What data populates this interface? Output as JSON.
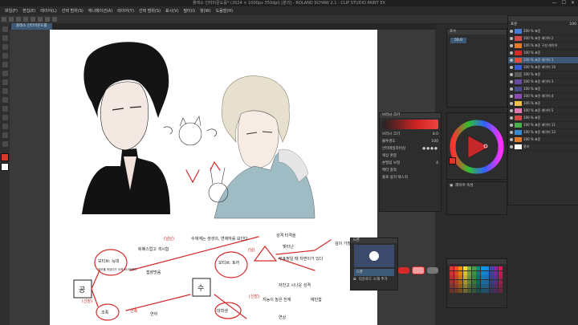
{
  "window": {
    "title": "플레소 인터미문도를* (2024 × 1000px 350dpi) [분리] - ROLAND SCHAW 2.1 - CLIP STUDIO PAINT EX",
    "controls": [
      "—",
      "☐",
      "✕"
    ]
  },
  "menu": [
    "파일(F)",
    "편집(E)",
    "레이어(L)",
    "선택 범위(S)",
    "애니메이션(A)",
    "레이어(Y)",
    "선택 범위(S)",
    "표시(V)",
    "필터(I)",
    "창(W)",
    "도움말(H)"
  ],
  "canvas_tab": "플레소 인터미문도를",
  "drawing": {
    "notes": [
      "수애계는 생생의, 연애하를 보인다.",
      "성격 타격을",
      "빛타난",
      "무표정일 때 차변이가 있다",
      "자잔고 시나운 성격",
      "모티브: 늑대",
      "퇴폐스럽고 섹시함",
      "접괄맛음",
      "모티브: 토끼",
      "외모를 먹었다가 오래 되어버렸다",
      "지능이 높은 천재",
      "예민함",
      "연상",
      "대학생",
      "조폭",
      "건축",
      "연하"
    ],
    "labels": {
      "left_box": "공",
      "mid_box": "수",
      "note_paren1": "(남남)",
      "note_paren2": "(남)",
      "note_paren3": "(신장)",
      "note_paren4": "(신장)",
      "side_note": "깊이 가장"
    }
  },
  "brush_panel": {
    "title": "브러시 크기",
    "rows": [
      {
        "label": "브러시 크기",
        "value": "8.0"
      },
      {
        "label": "불투명도",
        "value": "100"
      },
      {
        "label": "안티에일리어싱",
        "value": ""
      },
      {
        "label": "색상 혼합",
        "value": ""
      },
      {
        "label": "손떨림 보정",
        "value": "4"
      },
      {
        "label": "벡터 흡착",
        "value": ""
      },
      {
        "label": "플로 용지 텍스처",
        "value": ""
      }
    ]
  },
  "subtool_panel": {
    "title": "G펜",
    "item": "G펜",
    "add_label": "다운로드 소재 추가"
  },
  "navigator": {
    "zoom_label": "조수",
    "zoom_value": "50.0"
  },
  "color_wheel": {
    "main": "#e2352a",
    "sub": "#ffffff"
  },
  "layers": [
    {
      "name": "200 % 표준",
      "color": "#4a7ad0"
    },
    {
      "name": "100 % 표준 레이어 2",
      "color": "#d04a4a"
    },
    {
      "name": "100 % 표준 구성 레이어",
      "color": "#e27a2a"
    },
    {
      "name": "100 % 표준",
      "color": "#d42a2a"
    },
    {
      "name": "100 % 표준 레이어 1",
      "color": "#e84a3a"
    },
    {
      "name": "100 % 표준 레이어 10",
      "color": "#3a5ad0"
    },
    {
      "name": "100 % 표준",
      "color": "#5a5a5a"
    },
    {
      "name": "100 % 표준 레이어 3",
      "color": "#6a4aa0"
    },
    {
      "name": "100 % 표준",
      "color": "#4a4a8a"
    },
    {
      "name": "100 % 표준 레이어 4",
      "color": "#8a4ab0"
    },
    {
      "name": "100 % 표준",
      "color": "#f0c04a"
    },
    {
      "name": "100 % 표준 레이어 5",
      "color": "#e07ab0"
    },
    {
      "name": "100 % 표준",
      "color": "#d04a4a"
    },
    {
      "name": "100 % 표준 레이어 11",
      "color": "#4ab04a"
    },
    {
      "name": "100 % 표준 레이어 12",
      "color": "#3a8ad0"
    },
    {
      "name": "100 % 표준",
      "color": "#e07a2a"
    },
    {
      "name": "용지",
      "color": "#ffffff"
    }
  ],
  "layer_prop": {
    "title": "레이어 속성",
    "blend": "표준",
    "opacity": "100"
  }
}
